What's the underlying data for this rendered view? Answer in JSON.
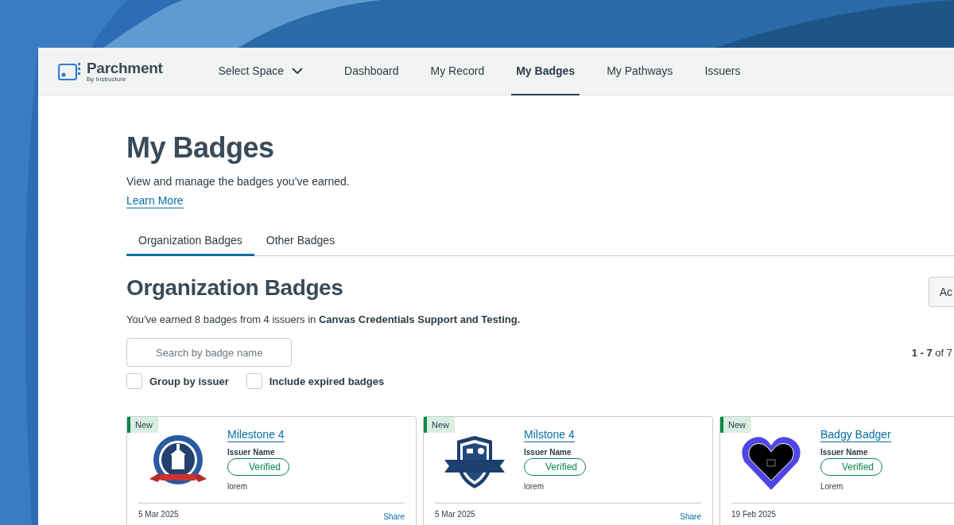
{
  "logo": {
    "name": "Parchment",
    "tagline": "By Instructure"
  },
  "nav": [
    {
      "label": "Select Space",
      "kind": "dropdown",
      "selected": false
    },
    {
      "label": "Dashboard",
      "kind": "link",
      "selected": false
    },
    {
      "label": "My Record",
      "kind": "link",
      "selected": false
    },
    {
      "label": "My Badges",
      "kind": "link",
      "selected": true
    },
    {
      "label": "My Pathways",
      "kind": "link",
      "selected": false
    },
    {
      "label": "Issuers",
      "kind": "link",
      "selected": false
    }
  ],
  "page": {
    "title": "My Badges",
    "description": "View and manage the badges you’ve earned.",
    "link": "Learn More"
  },
  "tabs": [
    {
      "label": "Organization Badges",
      "selected": true
    },
    {
      "label": "Other Badges",
      "selected": false
    }
  ],
  "section": {
    "title": "Organization Badges",
    "summary": "You've earned 8 badges from 4 issuers in **Canvas Credentials Support and Testing.**",
    "action_button": "Ac",
    "pagination": "**1 - 7** of 7"
  },
  "search": {
    "placeholder": "Search by badge name"
  },
  "filters": [
    {
      "label": "Group by issuer",
      "checked": false
    },
    {
      "label": "Include expired badges",
      "checked": false
    }
  ],
  "badges": [
    {
      "tag": "New",
      "kind": "college",
      "title": "Milestone 4",
      "issuer": "Issuer Name",
      "status": "Verified",
      "description": "lorem",
      "date": "5 Mar 2025",
      "share": "Share"
    },
    {
      "tag": "New",
      "kind": "shield",
      "title": "Milstone 4",
      "issuer": "Issuer Name",
      "status": "Verified",
      "description": "lorem",
      "date": "5 Mar 2025",
      "share": "Share"
    },
    {
      "tag": "New",
      "kind": "heart",
      "title": "Badgy Badger",
      "issuer": "Issuer Name",
      "status": "Verified",
      "description": "Lorem",
      "date": "19 Feb 2025"
    }
  ]
}
